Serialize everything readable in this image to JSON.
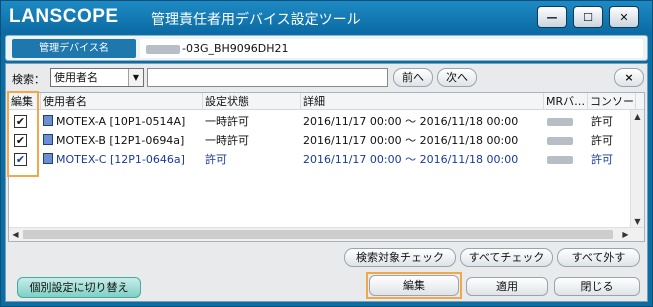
{
  "title_bar": {
    "logo": "LANSCOPE",
    "app_title": "管理責任者用デバイス設定ツール",
    "minimize": "—",
    "maximize": "☐",
    "close": "✕"
  },
  "device": {
    "label": "管理デバイス名",
    "value": "-03G_BH9096DH21"
  },
  "search": {
    "label": "検索：",
    "field_selected": "使用者名",
    "query": "",
    "prev_label": "前へ",
    "next_label": "次へ",
    "clear_label": "×"
  },
  "table": {
    "columns": [
      "編集",
      "使用者名",
      "設定状態",
      "詳細",
      "MRバ…",
      "コンソールの"
    ],
    "rows": [
      {
        "checked": "✔",
        "user": "MOTEX-A [10P1-0514A]",
        "status": "一時許可",
        "detail": "2016/11/17 00:00 ～ 2016/11/18 00:00",
        "console": "許可"
      },
      {
        "checked": "✔",
        "user": "MOTEX-B [12P1-0694a]",
        "status": "一時許可",
        "detail": "2016/11/17 00:00 ～ 2016/11/18 00:00",
        "console": "許可"
      },
      {
        "checked": "✔",
        "user": "MOTEX-C [12P1-0646a]",
        "status": "許可",
        "detail": "2016/11/17 00:00 ～ 2016/11/18 00:00",
        "console": "許可"
      }
    ]
  },
  "actions": {
    "check_filter": "検索対象チェック",
    "check_all": "すべてチェック",
    "uncheck_all": "すべて外す",
    "switch_individual": "個別設定に切り替え",
    "edit": "編集",
    "apply": "適用",
    "close": "閉じる"
  },
  "colors": {
    "window_bg": "#0a6ea4",
    "highlight": "#f0a84a",
    "selected_row_text": "#1a3a9c"
  }
}
